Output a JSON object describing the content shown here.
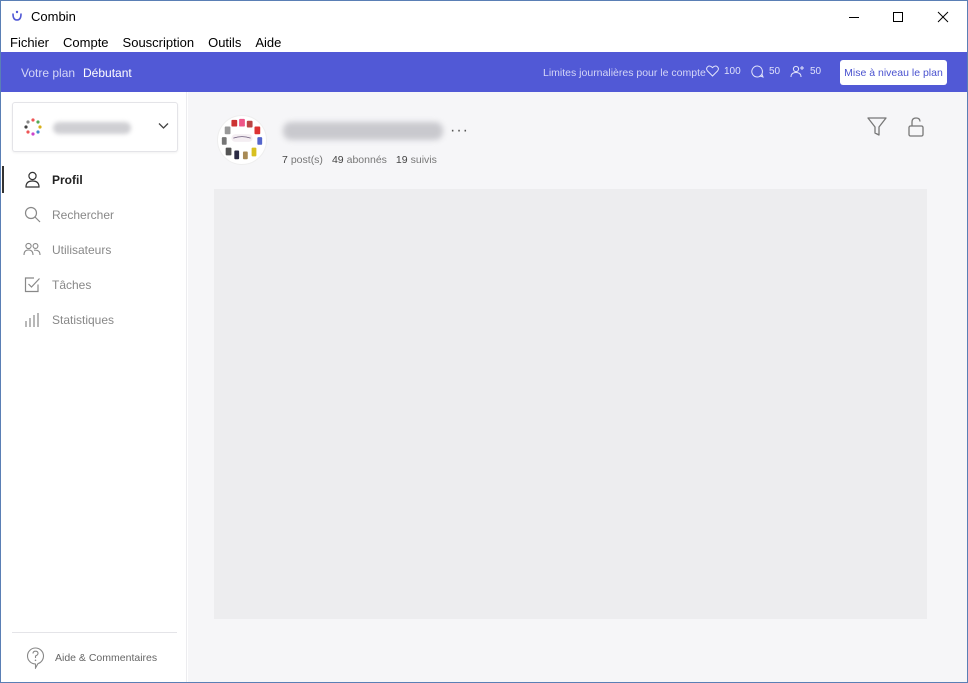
{
  "window": {
    "title": "Combin",
    "controls": {
      "minimize": "minimize-icon",
      "maximize": "maximize-icon",
      "close": "close-icon"
    }
  },
  "menu": {
    "items": [
      "Fichier",
      "Compte",
      "Souscription",
      "Outils",
      "Aide"
    ]
  },
  "plan_bar": {
    "plan_label": "Votre plan",
    "plan_name": "Débutant",
    "limits_label": "Limites journalières pour le compte",
    "likes_limit": "100",
    "comments_limit": "50",
    "follows_limit": "50",
    "upgrade_button": "Mise à niveau le plan",
    "colors": {
      "bar": "#5159d6",
      "button_text": "#4a52cf"
    }
  },
  "sidebar": {
    "nav": [
      {
        "label": "Profil",
        "icon": "user-icon",
        "active": true
      },
      {
        "label": "Rechercher",
        "icon": "search-icon",
        "active": false
      },
      {
        "label": "Utilisateurs",
        "icon": "users-icon",
        "active": false
      },
      {
        "label": "Tâches",
        "icon": "task-check-icon",
        "active": false
      },
      {
        "label": "Statistiques",
        "icon": "bar-chart-icon",
        "active": false
      }
    ],
    "help_label": "Aide & Commentaires"
  },
  "profile": {
    "more": "···",
    "posts_count": "7",
    "posts_label": "post(s)",
    "followers_count": "49",
    "followers_label": "abonnés",
    "following_count": "19",
    "following_label": "suivis"
  }
}
